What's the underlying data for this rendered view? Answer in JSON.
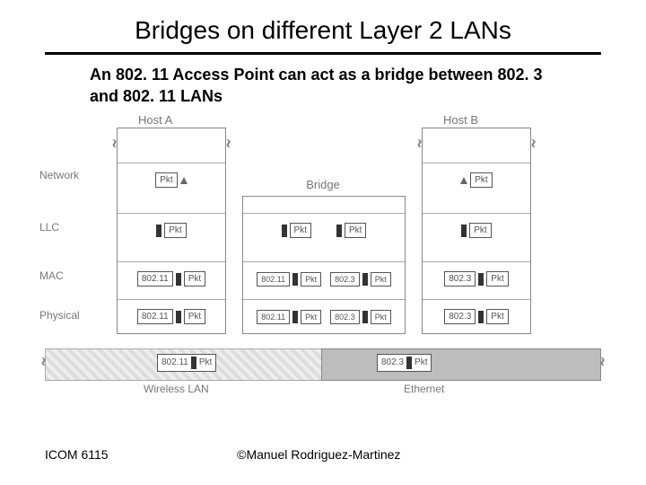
{
  "title": "Bridges on different Layer 2 LANs",
  "subtitle": "An 802. 11 Access Point can act as a bridge between 802. 3 and 802. 11 LANs",
  "layers": {
    "network": "Network",
    "llc": "LLC",
    "mac": "MAC",
    "physical": "Physical"
  },
  "hosts": {
    "a": "Host A",
    "b": "Host B"
  },
  "bridge_label": "Bridge",
  "pkt": "Pkt",
  "proto": {
    "w": "802.11",
    "e": "802.3"
  },
  "cable": {
    "wireless": "Wireless LAN",
    "ethernet": "Ethernet"
  },
  "footer": {
    "left": "ICOM 6115",
    "center": "©Manuel Rodriguez-Martinez"
  }
}
